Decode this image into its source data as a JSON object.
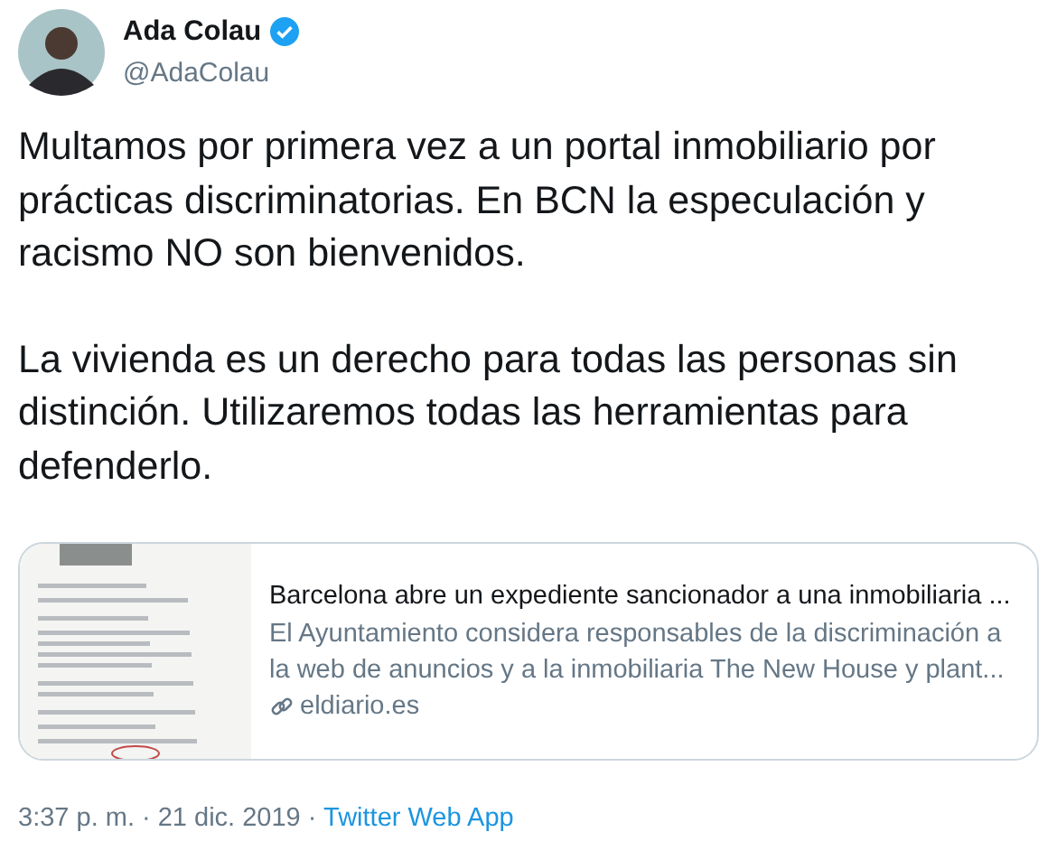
{
  "author": {
    "name": "Ada Colau",
    "verified": true,
    "handle": "@AdaColau"
  },
  "paragraphs": [
    "Multamos por primera vez a un portal inmobiliario por prácticas discriminatorias. En BCN la especulación y racismo NO son bienvenidos.",
    "La vivienda es un derecho para todas las personas sin distinción. Utilizaremos todas las herramientas para defenderlo."
  ],
  "link_card": {
    "title": "Barcelona abre un expediente sancionador a una inmobiliaria ...",
    "description": "El Ayuntamiento considera responsables de la discriminación a la web de anuncios y a la inmobiliaria The New House y plant...",
    "domain": "eldiario.es"
  },
  "meta": {
    "timestamp": "3:37 p. m. · 21 dic. 2019",
    "separator": "·",
    "source": "Twitter Web App"
  }
}
